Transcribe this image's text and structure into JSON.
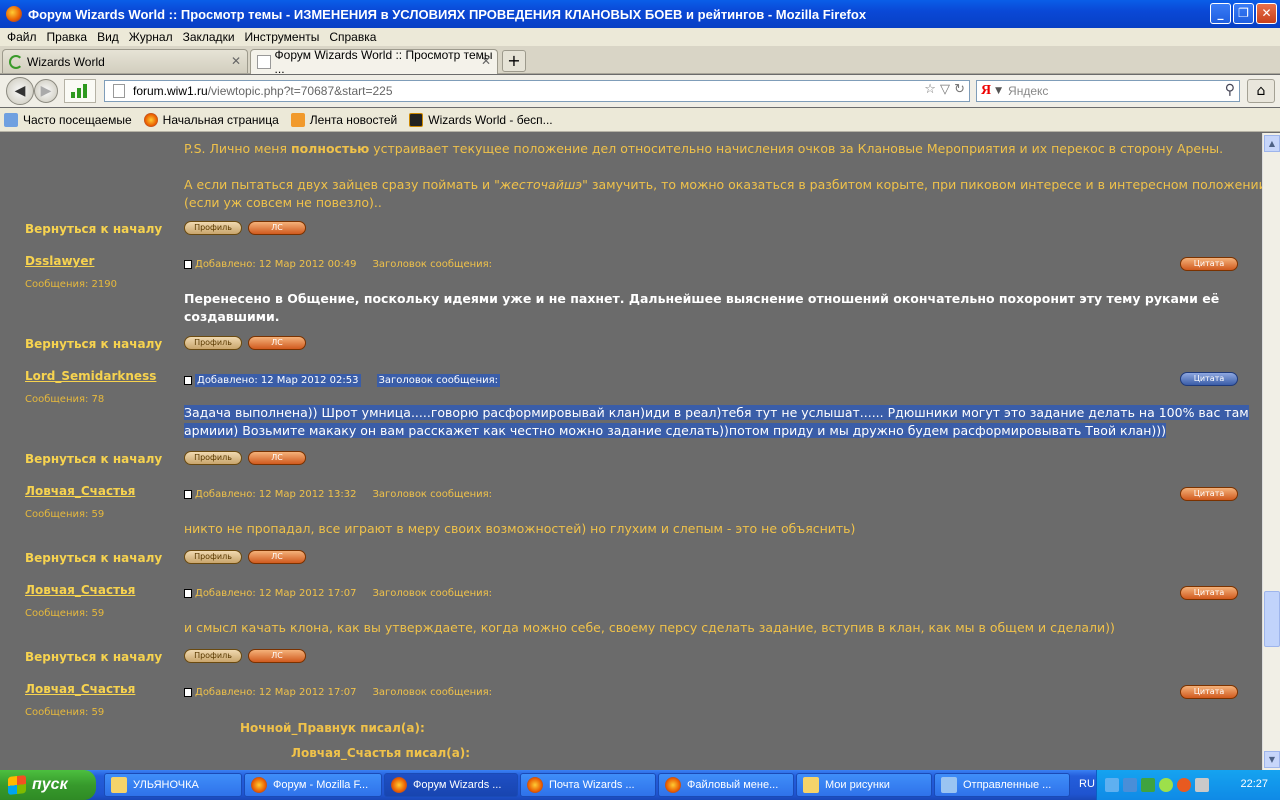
{
  "window": {
    "title": "Форум Wizards World :: Просмотр темы - ИЗМЕНЕНИЯ в УСЛОВИЯХ ПРОВЕДЕНИЯ КЛАНОВЫХ БОЕВ и рейтингов - Mozilla Firefox"
  },
  "menu": [
    "Файл",
    "Правка",
    "Вид",
    "Журнал",
    "Закладки",
    "Инструменты",
    "Справка"
  ],
  "tabs": [
    {
      "label": "Wizards World"
    },
    {
      "label": "Форум Wizards World :: Просмотр темы ..."
    }
  ],
  "nav": {
    "url_host": "forum.wiw1.ru",
    "url_path": "/viewtopic.php?t=70687&start=225",
    "search_engine": "Я",
    "search_placeholder": "Яндекс"
  },
  "bookmarks": [
    {
      "label": "Часто посещаемые"
    },
    {
      "label": "Начальная страница"
    },
    {
      "label": "Лента новостей"
    },
    {
      "label": "Wizards World - бесп..."
    }
  ],
  "forum": {
    "back_to_top": "Вернуться к началу",
    "profile_label": "Профиль",
    "pm_label": "ЛС",
    "quote_label": "Цитата",
    "subject_label": "Заголовок сообщения:",
    "intro": {
      "line1_pre": "P.S. Лично меня ",
      "line1_bold": "полностью",
      "line1_post": " устраивает текущее положение дел относительно начисления очков за Клановые Мероприятия и их перекос в сторону Арены.",
      "line2_pre": "А если пытаться двух зайцев сразу поймать и \"",
      "line2_italic": "жесточайшэ",
      "line2_post": "\" замучить, то можно оказаться в разбитом корыте, при пиковом интересе и в интересном положении",
      "line3": "(если уж совсем не повезло).."
    },
    "posts": [
      {
        "author": "Dsslawyer",
        "count": "Сообщения: 2190",
        "date": "Добавлено: 12 Мар 2012 00:49",
        "body1": "Перенесено в Общение, поскольку идеями уже и не пахнет. Дальнейшее выяснение отношений окончательно похоронит эту тему руками её",
        "body2": "создавшими."
      },
      {
        "author": "Lord_Semidarkness",
        "count": "Сообщения: 78",
        "date": "Добавлено: 12 Мар 2012 02:53",
        "body1": "Задача выполнена)) Шрот умница.....говорю расформировывай клан)иди в реал)тебя тут не услышат...... Рдюшники могут это задание делать на 100% вас там",
        "body2": "армиии) Возьмите макаку он вам расскажет как честно можно задание сделать))потом приду и мы дружно будем расформировывать Твой клан)))"
      },
      {
        "author": "Ловчая_Счастья",
        "count": "Сообщения: 59",
        "date": "Добавлено: 12 Мар 2012 13:32",
        "body1": "никто не пропадал, все играют в меру своих возможностей) но глухим и слепым - это не объяснить)"
      },
      {
        "author": "Ловчая_Счастья",
        "count": "Сообщения: 59",
        "date": "Добавлено: 12 Мар 2012 17:07",
        "body1": "и смысл качать клона, как вы утверждаете, когда можно себе, своему персу сделать задание, вступив в клан, как мы в общем и сделали))"
      },
      {
        "author": "Ловчая_Счастья",
        "count": "Сообщения: 59",
        "date": "Добавлено: 12 Мар 2012 17:07",
        "quote1": "Ночной_Правнук писал(а):",
        "quote2": "Ловчая_Счастья писал(а):"
      }
    ]
  },
  "taskbar": {
    "start": "пуск",
    "tasks": [
      "УЛЬЯНОЧКА",
      "Форум - Mozilla F...",
      "Форум Wizards ...",
      "Почта Wizards ...",
      "Файловый мене...",
      "Мои рисунки",
      "Отправленные ..."
    ],
    "lang": "RU",
    "clock": "22:27"
  },
  "colors": {
    "page_bg": "#6b6b6b",
    "forum_text": "#f0c24a",
    "selection": "#3a5da8",
    "xp_blue": "#245edb"
  }
}
